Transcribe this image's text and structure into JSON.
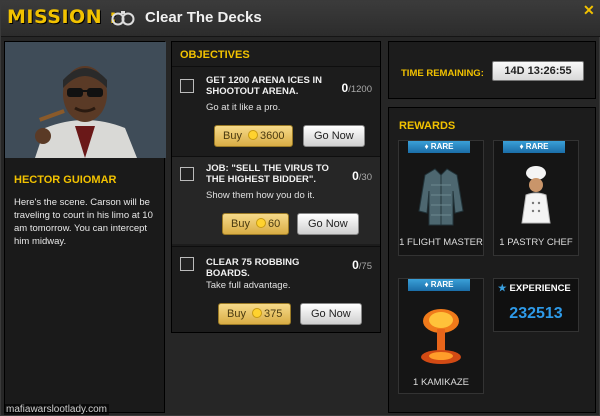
{
  "header": {
    "mission_label": "MISSION :",
    "mission_name": "Clear The Decks",
    "close_symbol": "✕"
  },
  "npc": {
    "name": "HECTOR GUIOMAR",
    "description": "Here's the scene. Carson will be traveling to court in his limo at 10 am tomorrow. You can intercept him midway."
  },
  "objectives": {
    "header": "OBJECTIVES",
    "items": [
      {
        "title": "GET 1200 ARENA ICES IN SHOOTOUT ARENA.",
        "subtitle": "Go at it like a pro.",
        "count": "0",
        "total": "/1200",
        "buy_label": "Buy",
        "buy_cost": "3600",
        "go_label": "Go Now"
      },
      {
        "title": "JOB: \"SELL THE VIRUS TO THE HIGHEST BIDDER\".",
        "subtitle": "Show them how you do it.",
        "count": "0",
        "total": "/30",
        "buy_label": "Buy",
        "buy_cost": "60",
        "go_label": "Go Now"
      },
      {
        "title": "CLEAR 75 ROBBING BOARDS.",
        "subtitle": "Take full advantage.",
        "count": "0",
        "total": "/75",
        "buy_label": "Buy",
        "buy_cost": "375",
        "go_label": "Go Now"
      }
    ]
  },
  "timer": {
    "label": "TIME REMAINING:",
    "value": "14D 13:26:55"
  },
  "rewards": {
    "header": "REWARDS",
    "rare_label": "♦ RARE",
    "items": [
      {
        "label": "1 FLIGHT MASTER",
        "icon": "jacket-icon"
      },
      {
        "label": "1 PASTRY CHEF",
        "icon": "chef-icon"
      },
      {
        "label": "1 KAMIKAZE",
        "icon": "explosion-icon"
      }
    ],
    "experience_label": "EXPERIENCE",
    "experience_value": "232513"
  },
  "watermark": "mafiawarslootlady.com",
  "colors": {
    "accent_yellow": "#f2c200",
    "rare_blue": "#2a86c4",
    "exp_blue": "#2e9ae8"
  }
}
